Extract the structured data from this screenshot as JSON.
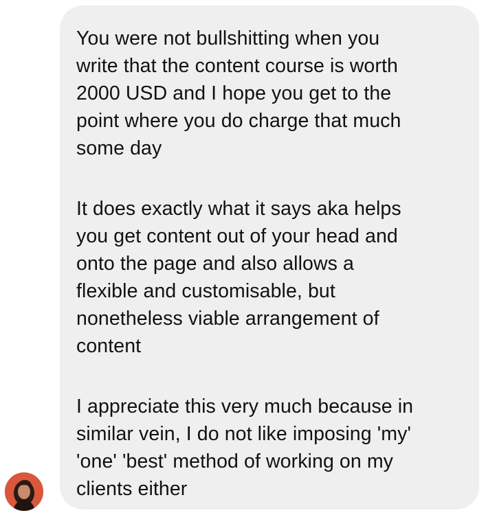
{
  "conversation": {
    "message": {
      "paragraphs": [
        "You were not bullshitting when you\nwrite that the content course is worth\n2000 USD and I hope you get to the\npoint where you do charge that much\nsome day",
        "It does exactly what it says aka helps\nyou get content out of your head and\nonto the page and also allows a\nflexible and customisable, but\nnonetheless viable arrangement of\ncontent",
        "I appreciate this very much because in\nsimilar vein, I do not like imposing 'my'\n'one' 'best' method of working on my\nclients either"
      ]
    },
    "sender": {
      "avatar_icon": "user-avatar"
    }
  },
  "colors": {
    "bubble_background": "#efefef",
    "text": "#111111",
    "avatar_background": "#d9573b"
  }
}
